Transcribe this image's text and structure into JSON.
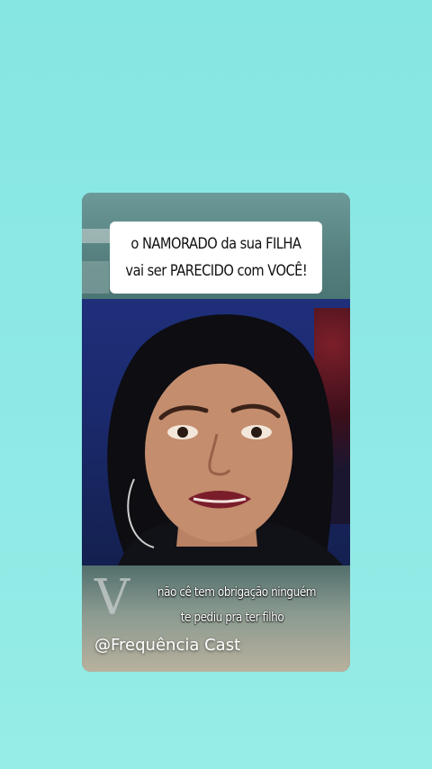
{
  "headline": {
    "line1": "o NAMORADO da sua FILHA",
    "line2": "vai ser PARECIDO com VOCÊ!"
  },
  "subtitle": {
    "line1": "não cê tem obrigação ninguém",
    "line2": "te pediu pra ter filho"
  },
  "watermark": "@Frequência Cast",
  "colors": {
    "background": "#8ee9e5",
    "headline_box": "#ffffff",
    "headline_text": "#111111",
    "subtitle_text": "#ffffff"
  }
}
